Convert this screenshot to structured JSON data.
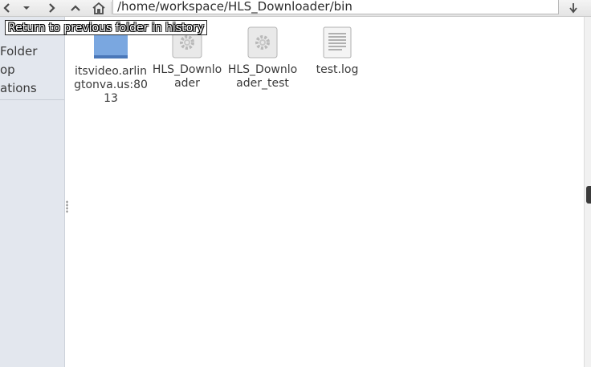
{
  "toolbar": {
    "path": "/home/workspace/HLS_Downloader/bin",
    "tooltip": "Return to previous folder in history"
  },
  "sidebar": {
    "items": [
      {
        "label": "Folder"
      },
      {
        "label": "op"
      },
      {
        "label": "ations"
      }
    ]
  },
  "files": [
    {
      "label": "itsvideo.arlingtonva.us:8013",
      "icon": "folder-icon"
    },
    {
      "label": "HLS_Downloader",
      "icon": "executable-icon"
    },
    {
      "label": "HLS_Downloader_test",
      "icon": "executable-icon"
    },
    {
      "label": "test.log",
      "icon": "text-file-icon"
    }
  ]
}
